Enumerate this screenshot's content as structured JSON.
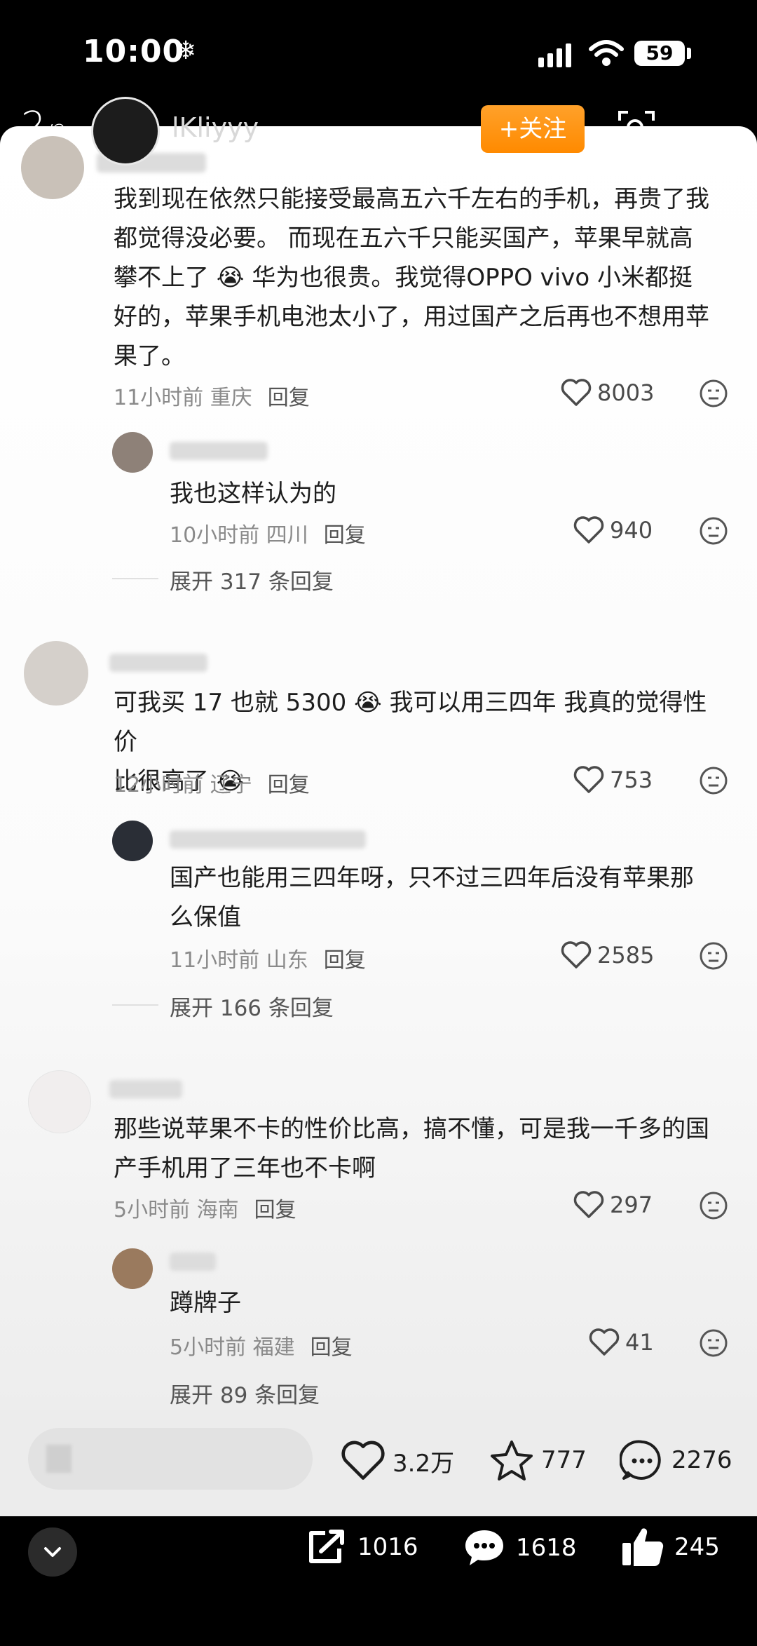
{
  "status_bar": {
    "time": "10:00",
    "battery": "59"
  },
  "header": {
    "page_current": "2",
    "page_total": "2",
    "username": "lKliyyy",
    "follow_label": "+关注"
  },
  "comments": [
    {
      "text_lines": [
        "我到现在依然只能接受最高五六千左右的手机，再贵了我",
        "都觉得没必要。 而现在五六千只能买国产，苹果早就高",
        "攀不上了",
        "华为也很贵。我觉得OPPO vivo 小米都挺",
        "好的，苹果手机电池太小了，用过国产之后再也不想用苹",
        "果了。"
      ],
      "time": "11小时前",
      "location": "重庆",
      "reply": "回复",
      "likes": "8003",
      "subreply": {
        "text": "我也这样认为的",
        "time": "10小时前",
        "location": "四川",
        "reply": "回复",
        "likes": "940"
      },
      "expand": "展开 317 条回复"
    },
    {
      "text_lines": [
        "可我买 17 也就 5300",
        "我可以用三四年 我真的觉得性价",
        "比很高了"
      ],
      "time": "12小时前",
      "location": "辽宁",
      "reply": "回复",
      "likes": "753",
      "subreply": {
        "text_lines": [
          "国产也能用三四年呀，只不过三四年后没有苹果那",
          "么保值"
        ],
        "time": "11小时前",
        "location": "山东",
        "reply": "回复",
        "likes": "2585"
      },
      "expand": "展开 166 条回复"
    },
    {
      "text_lines": [
        "那些说苹果不卡的性价比高，搞不懂，可是我一千多的国",
        "产手机用了三年也不卡啊"
      ],
      "time": "5小时前",
      "location": "海南",
      "reply": "回复",
      "likes": "297",
      "subreply": {
        "text": "蹲牌子",
        "time": "5小时前",
        "location": "福建",
        "reply": "回复",
        "likes": "41"
      },
      "expand": "展开 89 条回复"
    }
  ],
  "bottom_bar": {
    "likes": "3.2万",
    "favorites": "777",
    "comments": "2276"
  },
  "toolbar": {
    "share": "1016",
    "messages": "1618",
    "thumbs": "245"
  },
  "colors": {
    "follow": "#ff8a00",
    "sheet_bg": "#ffffff",
    "meta": "#8a8a8a"
  }
}
